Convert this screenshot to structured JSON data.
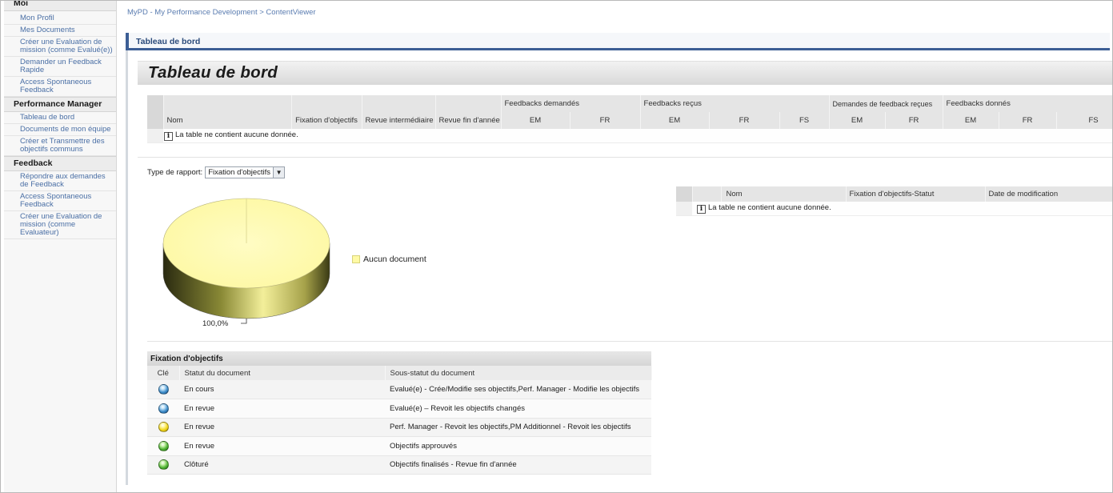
{
  "sidebar": {
    "categories": {
      "moi": "Moi",
      "performance_manager": "Performance Manager",
      "feedback": "Feedback"
    },
    "moi_items": [
      {
        "label": "Mon Profil"
      },
      {
        "label": "Mes Documents"
      },
      {
        "label": "Créer une Evaluation de mission (comme Evalué(e))"
      },
      {
        "label": "Demander un Feedback Rapide"
      },
      {
        "label": "Access Spontaneous Feedback"
      }
    ],
    "pm_items": [
      {
        "label": "Tableau de bord"
      },
      {
        "label": "Documents de mon équipe"
      },
      {
        "label": "Créer et Transmettre des objectifs communs"
      }
    ],
    "feedback_items": [
      {
        "label": "Répondre aux demandes de Feedback"
      },
      {
        "label": "Access Spontaneous Feedback"
      },
      {
        "label": "Créer une Evaluation de mission (comme Evaluateur)"
      }
    ]
  },
  "header": {
    "breadcrumb": "MyPD - My Performance Development > ContentViewer",
    "tab_title": "Tableau de bord",
    "page_title": "Tableau de bord"
  },
  "main_table": {
    "group_headers": {
      "feedbacks_demandes": "Feedbacks demandés",
      "feedbacks_recus": "Feedbacks reçus",
      "demandes_recues": "Demandes de feedback reçues",
      "feedbacks_donnes": "Feedbacks donnés"
    },
    "columns": {
      "nom": "Nom",
      "fixation": "Fixation d'objectifs",
      "revue_inter": "Revue intermédiaire",
      "revue_fin": "Revue fin d'année",
      "em": "EM",
      "fr": "FR",
      "fs": "FS"
    },
    "empty_message": "La table ne contient aucune donnée."
  },
  "report": {
    "label": "Type de rapport:",
    "selected": "Fixation d'objectifs"
  },
  "pie": {
    "legend_label": "Aucun document",
    "slice_label": "100,0%",
    "color": "#fffaa5"
  },
  "right_table": {
    "columns": {
      "nom": "Nom",
      "statut": "Fixation d'objectifs-Statut",
      "date": "Date de modification"
    },
    "empty_message": "La table ne contient aucune donnée."
  },
  "key_table": {
    "title": "Fixation d'objectifs",
    "columns": {
      "cle": "Clé",
      "statut": "Statut du document",
      "sous_statut": "Sous-statut du document"
    },
    "rows": [
      {
        "icon": "blue-ball-icon",
        "status": "En cours",
        "substatus": "Evalué(e) - Crée/Modifie ses objectifs,Perf. Manager - Modifie les objectifs"
      },
      {
        "icon": "blue-ball-icon",
        "status": "En revue",
        "substatus": "Evalué(e) – Revoit les objectifs changés"
      },
      {
        "icon": "yellow-ball-icon",
        "status": "En revue",
        "substatus": "Perf. Manager - Revoit les objectifs,PM Additionnel - Revoit les objectifs"
      },
      {
        "icon": "green-ball-icon",
        "status": "En revue",
        "substatus": "Objectifs approuvés"
      },
      {
        "icon": "green-ball-icon",
        "status": "Clôturé",
        "substatus": "Objectifs finalisés - Revue fin d'année"
      }
    ]
  },
  "colors": {
    "accent": "#3c5e95",
    "link": "#4a6fa5",
    "table_header": "#e5e5e5"
  }
}
